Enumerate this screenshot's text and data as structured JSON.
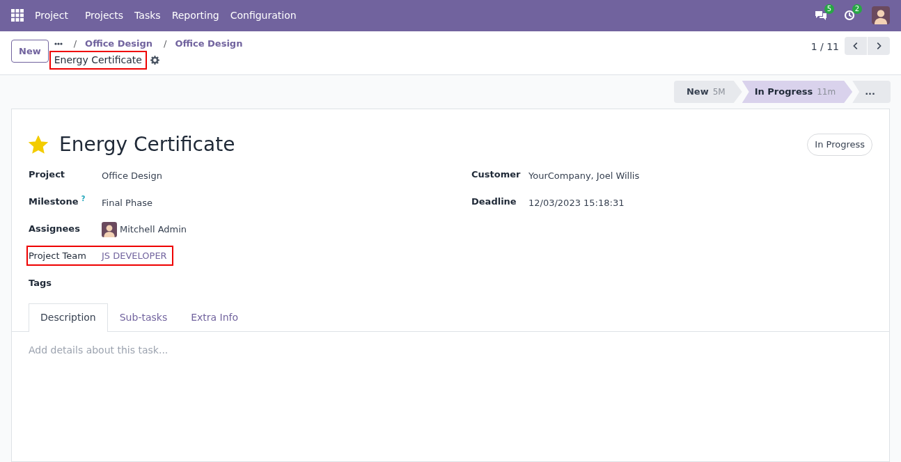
{
  "navbar": {
    "app": "Project",
    "menu": [
      "Projects",
      "Tasks",
      "Reporting",
      "Configuration"
    ],
    "messages_count": "5",
    "activities_count": "2"
  },
  "control_panel": {
    "new_button": "New",
    "separator": "/",
    "breadcrumbs": [
      "Office Design",
      "Office Design"
    ],
    "current": {
      "label": "Energy Certificate",
      "highlighted": true
    },
    "pager": "1 / 11"
  },
  "stages": [
    {
      "label": "New",
      "duration": "5M",
      "selected": false
    },
    {
      "label": "In Progress",
      "duration": "11m",
      "selected": true
    }
  ],
  "stage_more": "...",
  "task": {
    "starred": true,
    "title": "Energy Certificate",
    "state": "In Progress",
    "left_fields": [
      {
        "label": "Project",
        "value": "Office Design",
        "kind": "text",
        "highlighted": false
      },
      {
        "label": "Milestone",
        "help": "?",
        "value": "Final Phase",
        "kind": "text",
        "highlighted": false
      },
      {
        "label": "Assignees",
        "value": "Mitchell Admin",
        "kind": "user",
        "highlighted": false
      },
      {
        "label": "Project Team",
        "value": "JS DEVELOPER",
        "kind": "link",
        "highlighted": true
      },
      {
        "label": "Tags",
        "kind": "text",
        "highlighted": false
      }
    ],
    "right_fields": [
      {
        "label": "Customer",
        "value": "YourCompany, Joel Willis",
        "kind": "text",
        "highlighted": false
      },
      {
        "label": "Deadline",
        "value": "12/03/2023 15:18:31",
        "kind": "text",
        "highlighted": false
      }
    ],
    "tabs": [
      {
        "label": "Description",
        "selected": true
      },
      {
        "label": "Sub-tasks",
        "selected": false
      },
      {
        "label": "Extra Info",
        "selected": false
      }
    ],
    "description_placeholder": "Add details about this task..."
  }
}
